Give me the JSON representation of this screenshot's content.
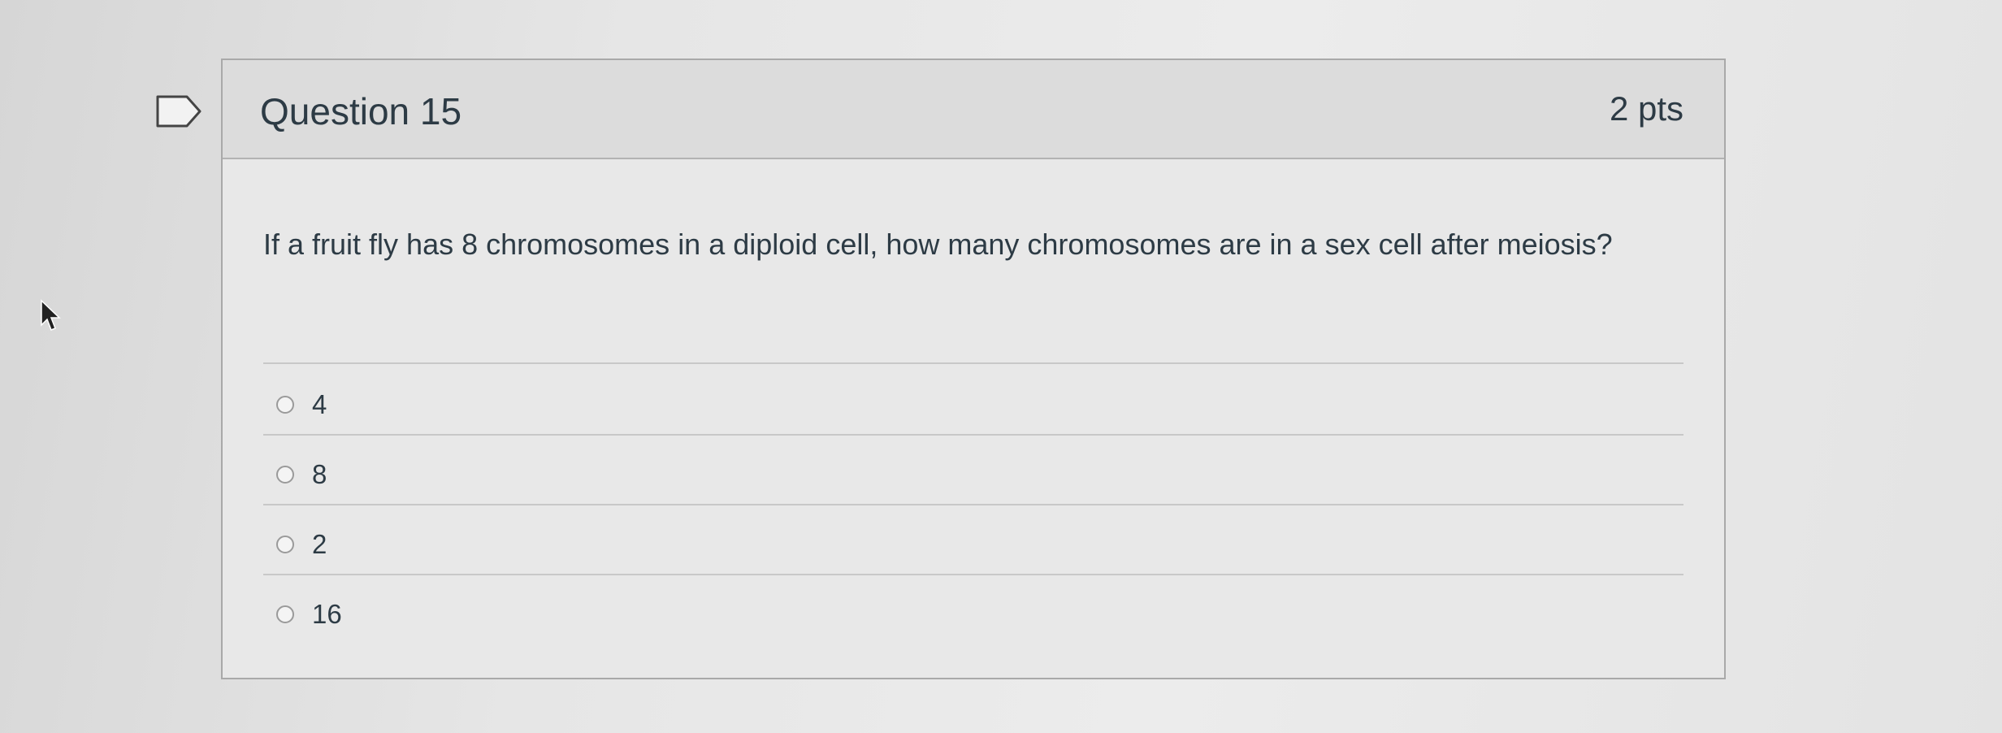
{
  "question": {
    "title": "Question 15",
    "points": "2 pts",
    "text": "If a fruit fly has 8 chromosomes in a diploid cell, how many chromosomes are in a sex cell after meiosis?",
    "answers": [
      {
        "label": "4",
        "selected": false
      },
      {
        "label": "8",
        "selected": false
      },
      {
        "label": "2",
        "selected": false
      },
      {
        "label": "16",
        "selected": false
      }
    ]
  },
  "icons": {
    "flag": "flag-icon",
    "cursor": "mouse-pointer-icon"
  },
  "colors": {
    "text": "#2d3b45",
    "header_bg": "#dcdcdc",
    "border": "#a9a9a9"
  }
}
